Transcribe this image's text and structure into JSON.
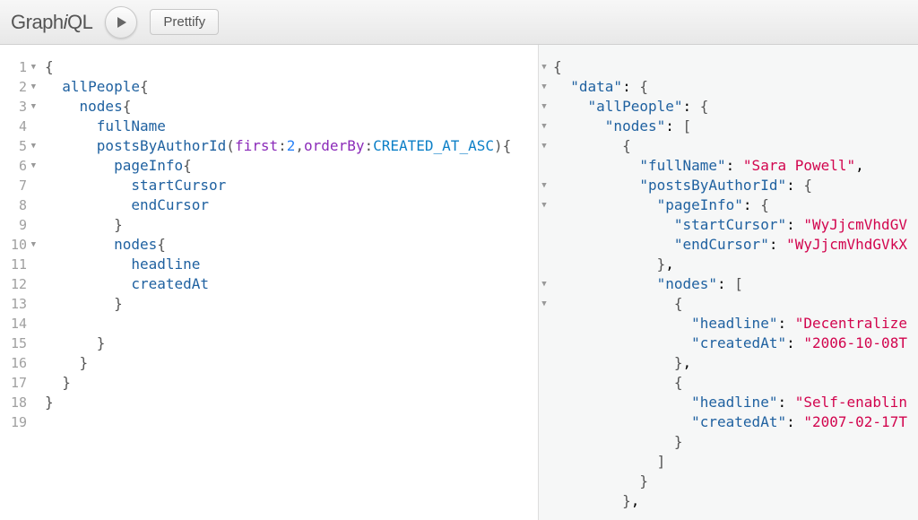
{
  "app": {
    "name_pre": "Graph",
    "name_em": "i",
    "name_post": "QL"
  },
  "toolbar": {
    "prettify_label": "Prettify"
  },
  "query": {
    "lines": [
      {
        "n": 1,
        "fold": true
      },
      {
        "n": 2,
        "fold": true
      },
      {
        "n": 3,
        "fold": true
      },
      {
        "n": 4,
        "fold": false
      },
      {
        "n": 5,
        "fold": true
      },
      {
        "n": 6,
        "fold": true
      },
      {
        "n": 7,
        "fold": false
      },
      {
        "n": 8,
        "fold": false
      },
      {
        "n": 9,
        "fold": false
      },
      {
        "n": 10,
        "fold": true
      },
      {
        "n": 11,
        "fold": false
      },
      {
        "n": 12,
        "fold": false
      },
      {
        "n": 13,
        "fold": false
      },
      {
        "n": 14,
        "fold": false
      },
      {
        "n": 15,
        "fold": false
      },
      {
        "n": 16,
        "fold": false
      },
      {
        "n": 17,
        "fold": false
      },
      {
        "n": 18,
        "fold": false
      },
      {
        "n": 19,
        "fold": false
      }
    ],
    "q": {
      "root": "allPeople",
      "nodes": "nodes",
      "fullName": "fullName",
      "posts": "postsByAuthorId",
      "arg_first": "first",
      "val_first": "2",
      "arg_orderBy": "orderBy",
      "val_orderBy": "CREATED_AT_ASC",
      "pageInfo": "pageInfo",
      "startCursor": "startCursor",
      "endCursor": "endCursor",
      "nodes2": "nodes",
      "headline": "headline",
      "createdAt": "createdAt"
    }
  },
  "result": {
    "k_data": "\"data\"",
    "k_allPeople": "\"allPeople\"",
    "k_nodes": "\"nodes\"",
    "k_fullName": "\"fullName\"",
    "v_fullName": "\"Sara Powell\"",
    "k_postsByAuthorId": "\"postsByAuthorId\"",
    "k_pageInfo": "\"pageInfo\"",
    "k_startCursor": "\"startCursor\"",
    "v_startCursor": "\"WyJjcmVhdGV",
    "k_endCursor": "\"endCursor\"",
    "v_endCursor": "\"WyJjcmVhdGVkX",
    "k_headline": "\"headline\"",
    "v_headline1": "\"Decentralize",
    "k_createdAt": "\"createdAt\"",
    "v_createdAt1": "\"2006-10-08T",
    "v_headline2": "\"Self-enablin",
    "v_createdAt2": "\"2007-02-17T"
  }
}
